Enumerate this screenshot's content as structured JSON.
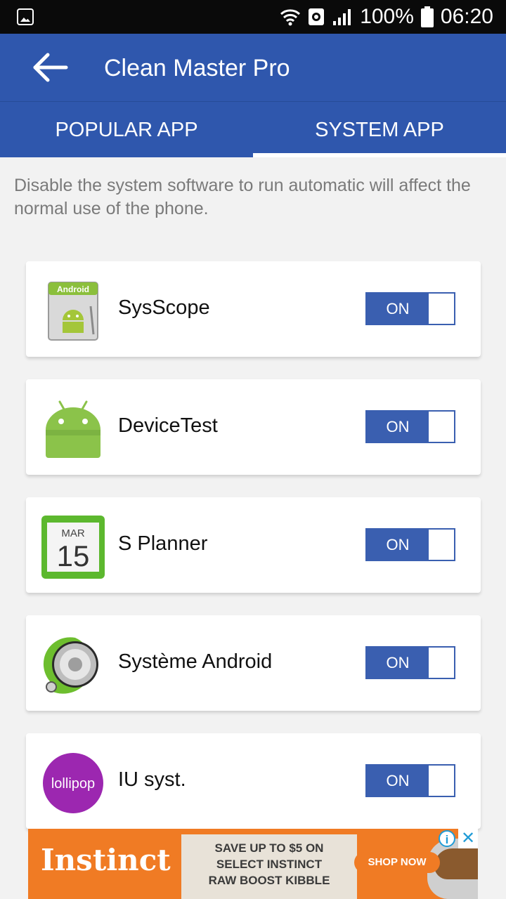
{
  "status_bar": {
    "battery": "100%",
    "time": "06:20",
    "icons": [
      "image-notification-icon",
      "wifi-icon",
      "vpn-icon",
      "signal-icon",
      "battery-icon"
    ]
  },
  "header": {
    "title": "Clean Master Pro",
    "back_icon": "arrow-left-icon"
  },
  "tabs": [
    {
      "label": "POPULAR APP",
      "active": false
    },
    {
      "label": "SYSTEM APP",
      "active": true
    }
  ],
  "description": "Disable the system software to run automatic will affect the normal use of the phone.",
  "apps": [
    {
      "name": "SysScope",
      "toggle": "ON",
      "icon": "android-box-icon"
    },
    {
      "name": "DeviceTest",
      "toggle": "ON",
      "icon": "android-robot-icon"
    },
    {
      "name": "S Planner",
      "toggle": "ON",
      "icon": "calendar-icon",
      "icon_month": "MAR",
      "icon_day": "15"
    },
    {
      "name": "Système Android",
      "toggle": "ON",
      "icon": "system-android-icon"
    },
    {
      "name": "IU syst.",
      "toggle": "ON",
      "icon": "lollipop-icon",
      "icon_text": "lollipop"
    }
  ],
  "ad": {
    "brand": "Instinct",
    "lines": [
      "SAVE UP TO $5 ON",
      "SELECT INSTINCT",
      "RAW BOOST KIBBLE"
    ],
    "cta": "SHOP NOW",
    "info_icon": "i",
    "close_icon": "✕"
  },
  "colors": {
    "primary": "#2f57ad",
    "toggle": "#3a5fb0",
    "ad_orange": "#f07b24"
  }
}
